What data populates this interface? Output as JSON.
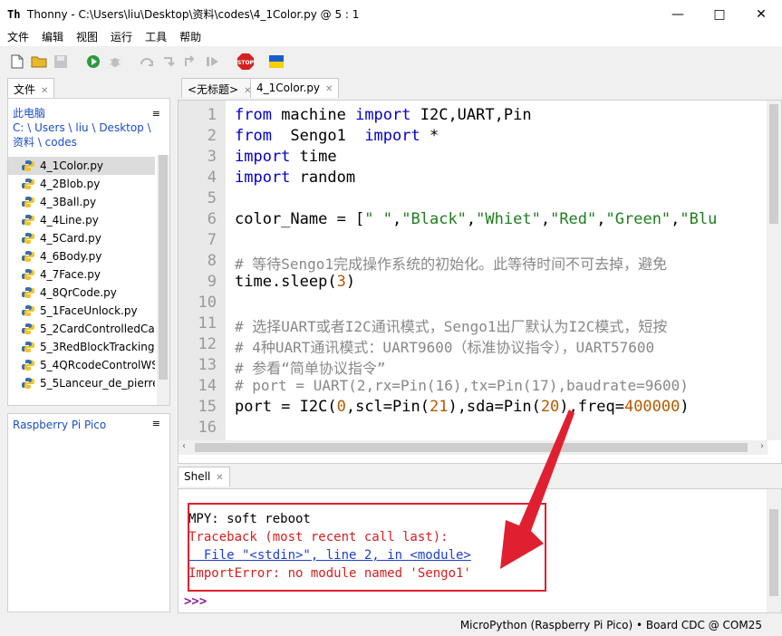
{
  "window": {
    "title": "Thonny  -  C:\\Users\\liu\\Desktop\\资料\\codes\\4_1Color.py  @  5 : 1"
  },
  "menu": [
    "文件",
    "编辑",
    "视图",
    "运行",
    "工具",
    "帮助"
  ],
  "files": {
    "tab_label": "文件",
    "computer_label": "此电脑",
    "path": "C: \\ Users \\ liu \\ Desktop \\ 资料 \\ codes",
    "items": [
      "4_1Color.py",
      "4_2Blob.py",
      "4_3Ball.py",
      "4_4Line.py",
      "4_5Card.py",
      "4_6Body.py",
      "4_7Face.py",
      "4_8QrCode.py",
      "5_1FaceUnlock.py",
      "5_2CardControlledCar",
      "5_3RedBlockTracking.",
      "5_4QRcodeControlWS",
      "5_5Lanceur_de_pierre."
    ],
    "device_label": "Raspberry Pi Pico"
  },
  "editor": {
    "tabs": [
      "<无标题>",
      "4_1Color.py"
    ],
    "line_numbers": [
      "1",
      "2",
      "3",
      "4",
      "5",
      "6",
      "7",
      "8",
      "9",
      "10",
      "11",
      "12",
      "13",
      "14",
      "15",
      "16"
    ],
    "lines": {
      "l1": {
        "a": "from",
        "b": " machine ",
        "c": "import",
        "d": " I2C,UART,Pin"
      },
      "l2": {
        "a": "from",
        "b": "  Sengo1  ",
        "c": "import",
        "d": " *"
      },
      "l3": {
        "a": "import",
        "b": " time"
      },
      "l4": {
        "a": "import",
        "b": " random"
      },
      "l6": {
        "a": "color_Name = [",
        "s1": "\" \"",
        "c1": ",",
        "s2": "\"Black\"",
        "c2": ",",
        "s3": "\"Whiet\"",
        "c3": ",",
        "s4": "\"Red\"",
        "c4": ",",
        "s5": "\"Green\"",
        "c5": ",",
        "s6": "\"Blu"
      },
      "l8": "# 等待Sengo1完成操作系统的初始化。此等待时间不可去掉，避免",
      "l9": {
        "a": "time.sleep(",
        "n": "3",
        "b": ")"
      },
      "l11": "# 选择UART或者I2C通讯模式，Sengo1出厂默认为I2C模式，短按",
      "l12": "# 4种UART通讯模式：UART9600（标准协议指令），UART57600",
      "l13": "# 参看“简单协议指令”",
      "l14": "# port = UART(2,rx=Pin(16),tx=Pin(17),baudrate=9600)",
      "l15": {
        "a": "port = I2C(",
        "n1": "0",
        "b": ",scl=Pin(",
        "n2": "21",
        "c": "),sda=Pin(",
        "n3": "20",
        "d": "),freq=",
        "n4": "400000",
        "e": ")"
      }
    }
  },
  "shell": {
    "tab_label": "Shell",
    "lines": [
      "MPY: soft reboot",
      "Traceback (most recent call last):",
      "  File \"<stdin>\", line 2, in <module>",
      "ImportError: no module named 'Sengo1'"
    ],
    "prompt": ">>>"
  },
  "status": "MicroPython (Raspberry Pi Pico)  •  Board CDC @ COM25",
  "colors": {
    "annotation": "#e02030",
    "link": "#1a4ec8"
  }
}
